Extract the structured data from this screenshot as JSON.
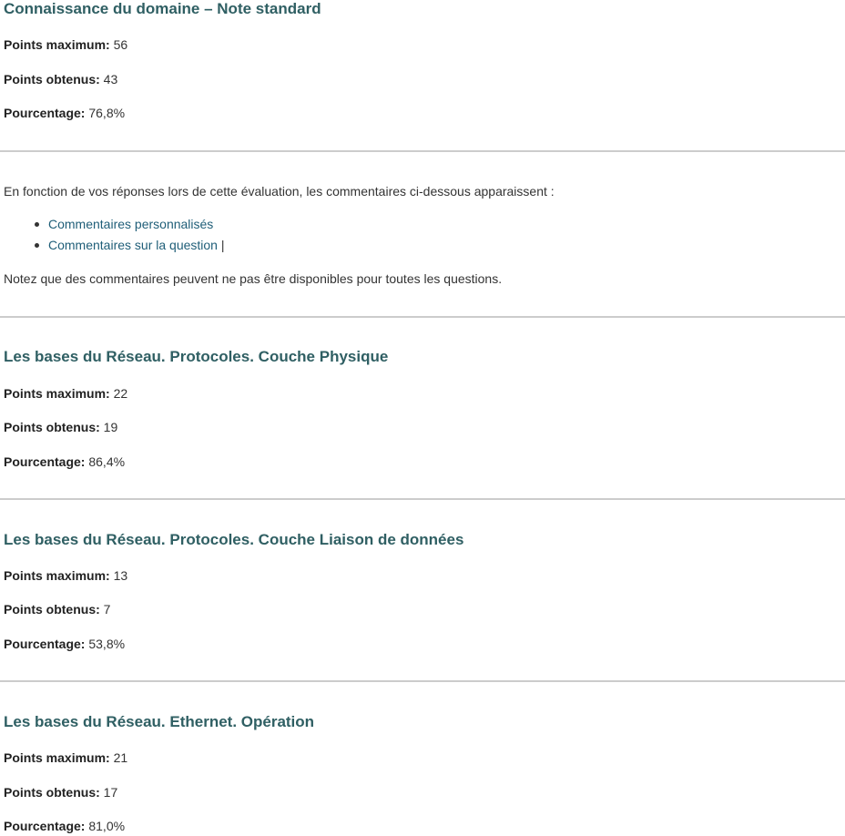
{
  "sections": [
    {
      "title": "Connaissance du domaine – Note standard",
      "max_label": "Points maximum:",
      "max_value": "56",
      "obtained_label": "Points obtenus:",
      "obtained_value": "43",
      "percent_label": "Pourcentage:",
      "percent_value": "76,8%"
    },
    {
      "title": "Les bases du Réseau. Protocoles. Couche Physique",
      "max_label": "Points maximum:",
      "max_value": "22",
      "obtained_label": "Points obtenus:",
      "obtained_value": "19",
      "percent_label": "Pourcentage:",
      "percent_value": "86,4%"
    },
    {
      "title": "Les bases du Réseau. Protocoles. Couche Liaison de données",
      "max_label": "Points maximum:",
      "max_value": "13",
      "obtained_label": "Points obtenus:",
      "obtained_value": "7",
      "percent_label": "Pourcentage:",
      "percent_value": "53,8%"
    },
    {
      "title": "Les bases du Réseau. Ethernet. Opération",
      "max_label": "Points maximum:",
      "max_value": "21",
      "obtained_label": "Points obtenus:",
      "obtained_value": "17",
      "percent_label": "Pourcentage:",
      "percent_value": "81,0%"
    }
  ],
  "feedback": {
    "intro": "En fonction de vos réponses lors de cette évaluation, les commentaires ci-dessous apparaissent :",
    "links": [
      {
        "label": "Commentaires personnalisés",
        "suffix": ""
      },
      {
        "label": "Commentaires sur la question",
        "suffix": " |"
      }
    ],
    "note": "Notez que des commentaires peuvent ne pas être disponibles pour toutes les questions."
  },
  "colors": {
    "heading": "#2f5f63",
    "link": "#1f5e78",
    "text": "#333333",
    "rule": "#cccccc"
  }
}
